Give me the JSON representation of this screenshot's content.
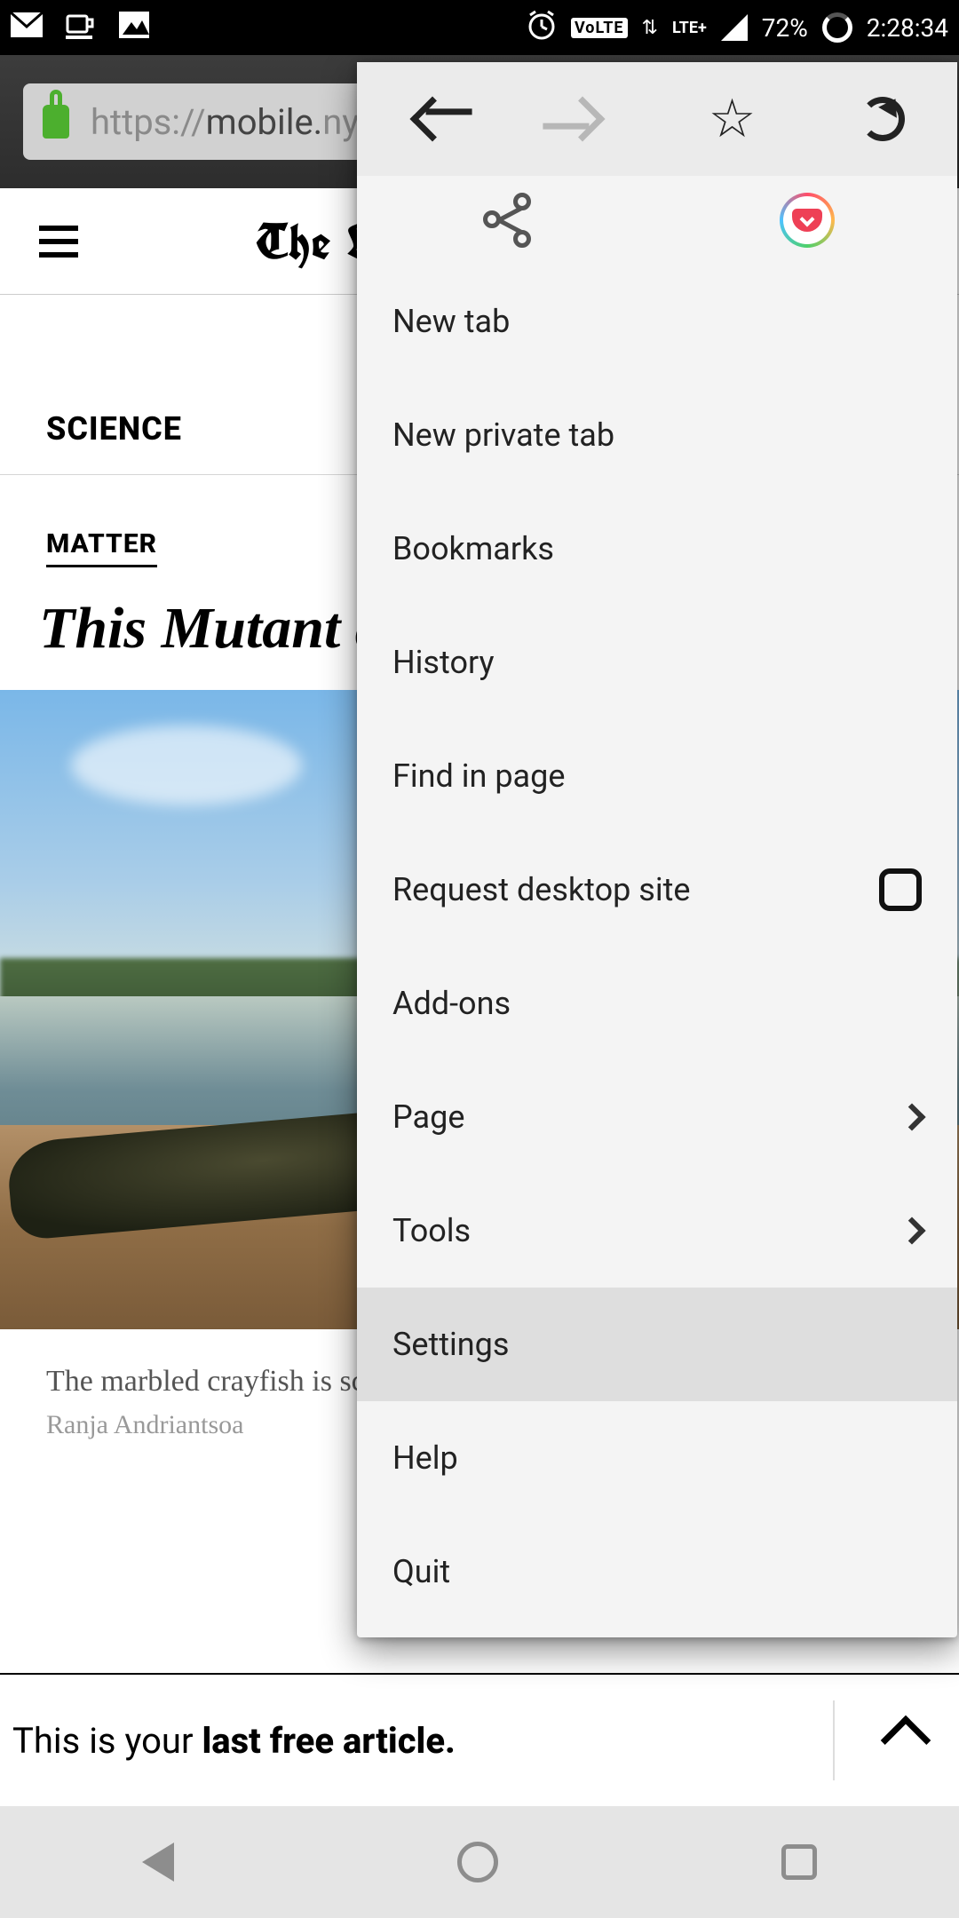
{
  "status": {
    "battery": "72%",
    "time": "2:28:34",
    "volte": "VoLTE",
    "lte": "LTE+"
  },
  "urlbar": {
    "prefix": "https://",
    "host": "mobile.",
    "truncated": "nyt"
  },
  "menu": {
    "items": {
      "newtab": "New tab",
      "newprivate": "New private tab",
      "bookmarks": "Bookmarks",
      "history": "History",
      "find": "Find in page",
      "desktop": "Request desktop site",
      "addons": "Add-ons",
      "page": "Page",
      "tools": "Tools",
      "settings": "Settings",
      "help": "Help",
      "quit": "Quit"
    }
  },
  "article": {
    "brand": "The New York Times",
    "section": "SCIENCE",
    "kicker": "MATTER",
    "headline": "This Mutant and It's Taki",
    "caption": "The marbled crayfish is scientists report. The p species appears to have",
    "credit": "Ranja Andriantsoa"
  },
  "paywall": {
    "prefix": "This is your ",
    "bold": "last free article."
  }
}
